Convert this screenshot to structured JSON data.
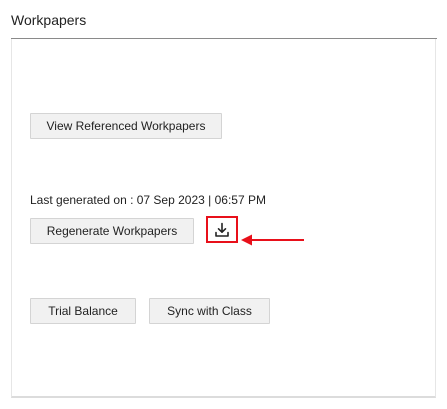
{
  "section": {
    "title": "Workpapers"
  },
  "buttons": {
    "view_referenced": "View Referenced Workpapers",
    "regenerate": "Regenerate Workpapers",
    "trial_balance": "Trial Balance",
    "sync_with_class": "Sync with Class"
  },
  "status": {
    "last_generated": "Last generated on : 07 Sep 2023 | 06:57 PM"
  },
  "icons": {
    "download": "download-icon",
    "annotation": "red-arrow-icon"
  },
  "colors": {
    "annotation_red": "#e8101a",
    "button_bg": "#f1f1f1",
    "rule": "#8a8a8a"
  }
}
